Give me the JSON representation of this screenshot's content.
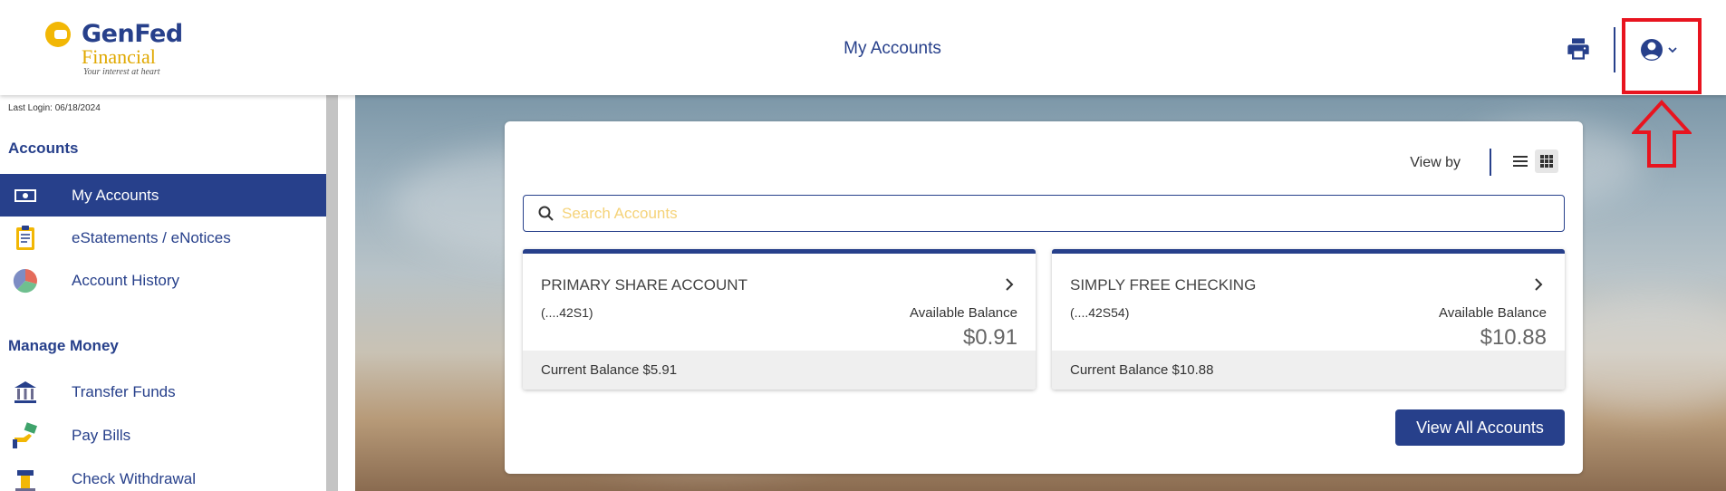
{
  "colors": {
    "brand_blue": "#27408b",
    "brand_gold": "#f2b705",
    "highlight_red": "#e8141f"
  },
  "header": {
    "logo": {
      "name": "GenFed",
      "sub": "Financial",
      "tagline": "Your interest at heart"
    },
    "title": "My Accounts",
    "icons": {
      "print": "printer-icon",
      "user": "user-circle-icon",
      "dropdown": "chevron-down-icon"
    }
  },
  "annotation": {
    "box": "highlight-rectangle",
    "arrow": "up-arrow"
  },
  "sidebar": {
    "last_login": "Last Login: 06/18/2024",
    "sections": [
      {
        "title": "Accounts",
        "items": [
          {
            "label": "My Accounts",
            "icon": "money-icon",
            "active": true
          },
          {
            "label": "eStatements / eNotices",
            "icon": "clipboard-icon"
          },
          {
            "label": "Account History",
            "icon": "pie-chart-icon"
          }
        ]
      },
      {
        "title": "Manage Money",
        "items": [
          {
            "label": "Transfer Funds",
            "icon": "bank-icon"
          },
          {
            "label": "Pay Bills",
            "icon": "hand-money-icon"
          },
          {
            "label": "Check Withdrawal",
            "icon": "check-icon"
          }
        ]
      }
    ]
  },
  "main": {
    "view_by": "View by",
    "view_modes": [
      "list-view-icon",
      "grid-view-icon"
    ],
    "active_view": "grid",
    "search": {
      "placeholder": "Search Accounts",
      "value": ""
    },
    "accounts": [
      {
        "name": "PRIMARY SHARE ACCOUNT",
        "number": "(....42S1)",
        "available_label": "Available Balance",
        "available_balance": "$0.91",
        "current_balance": "Current Balance $5.91"
      },
      {
        "name": "SIMPLY FREE CHECKING",
        "number": "(....42S54)",
        "available_label": "Available Balance",
        "available_balance": "$10.88",
        "current_balance": "Current Balance $10.88"
      }
    ],
    "view_all_label": "View All Accounts"
  }
}
